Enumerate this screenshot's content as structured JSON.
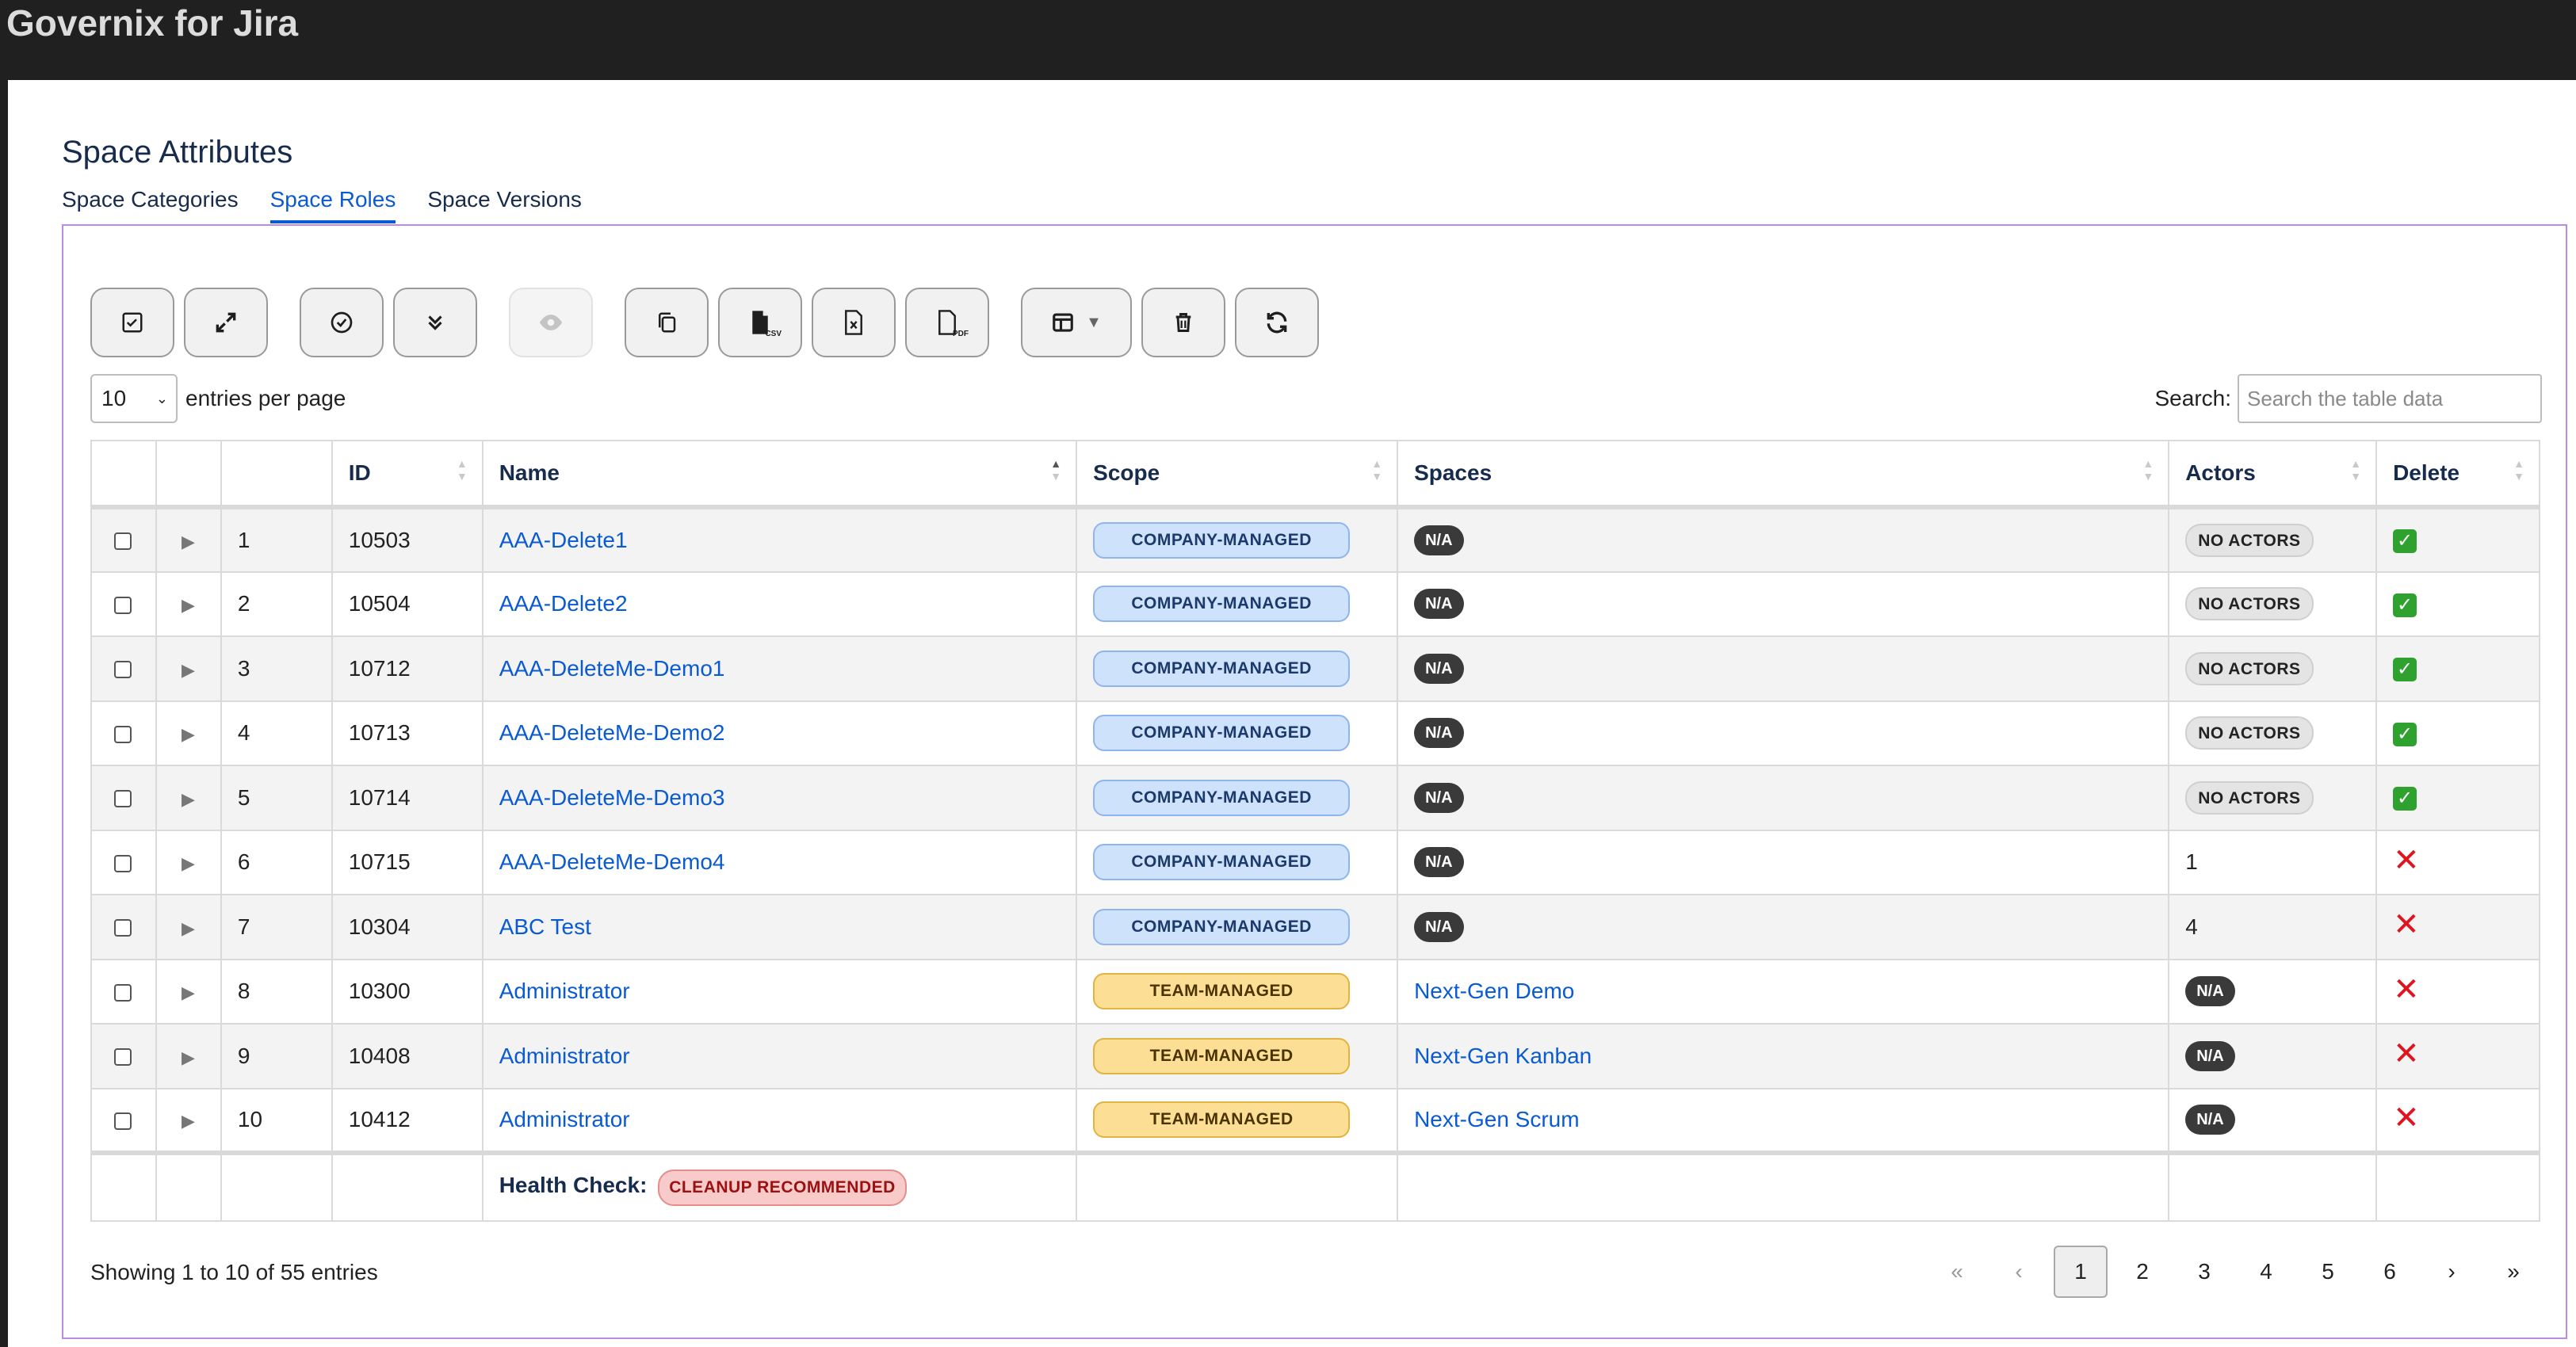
{
  "app": {
    "title": "Governix for Jira"
  },
  "page": {
    "title": "Space Attributes"
  },
  "tabs": [
    {
      "label": "Space Categories",
      "active": false
    },
    {
      "label": "Space Roles",
      "active": true
    },
    {
      "label": "Space Versions",
      "active": false
    }
  ],
  "toolbar": {
    "buttons": [
      {
        "name": "select-all-button",
        "icon": "checkbox-icon"
      },
      {
        "name": "expand-button",
        "icon": "expand-arrows-icon"
      },
      {
        "name": "check-button",
        "icon": "check-circle-icon"
      },
      {
        "name": "collapse-all-button",
        "icon": "double-chevron-down-icon"
      },
      {
        "name": "view-button",
        "icon": "eye-icon",
        "disabled": true
      },
      {
        "name": "copy-button",
        "icon": "copy-icon"
      },
      {
        "name": "export-csv-button",
        "icon": "csv-file-icon",
        "label": "CSV"
      },
      {
        "name": "export-excel-button",
        "icon": "excel-file-icon"
      },
      {
        "name": "export-pdf-button",
        "icon": "pdf-file-icon",
        "label": "PDF"
      },
      {
        "name": "columns-button",
        "icon": "columns-icon"
      },
      {
        "name": "delete-button",
        "icon": "trash-icon"
      },
      {
        "name": "refresh-button",
        "icon": "refresh-icon"
      }
    ]
  },
  "length": {
    "value": "10",
    "label": "entries per page"
  },
  "search": {
    "label": "Search:",
    "placeholder": "Search the table data"
  },
  "table": {
    "headers": [
      "",
      "",
      "",
      "ID",
      "Name",
      "Scope",
      "Spaces",
      "Actors",
      "Delete"
    ],
    "rows": [
      {
        "n": "1",
        "id": "10503",
        "name": "AAA-Delete1",
        "scope": "COMPANY-MANAGED",
        "scope_type": "company",
        "spaces": "N/A",
        "spaces_type": "badge",
        "actors": "NO ACTORS",
        "actors_type": "noactors",
        "delete": true
      },
      {
        "n": "2",
        "id": "10504",
        "name": "AAA-Delete2",
        "scope": "COMPANY-MANAGED",
        "scope_type": "company",
        "spaces": "N/A",
        "spaces_type": "badge",
        "actors": "NO ACTORS",
        "actors_type": "noactors",
        "delete": true
      },
      {
        "n": "3",
        "id": "10712",
        "name": "AAA-DeleteMe-Demo1",
        "scope": "COMPANY-MANAGED",
        "scope_type": "company",
        "spaces": "N/A",
        "spaces_type": "badge",
        "actors": "NO ACTORS",
        "actors_type": "noactors",
        "delete": true
      },
      {
        "n": "4",
        "id": "10713",
        "name": "AAA-DeleteMe-Demo2",
        "scope": "COMPANY-MANAGED",
        "scope_type": "company",
        "spaces": "N/A",
        "spaces_type": "badge",
        "actors": "NO ACTORS",
        "actors_type": "noactors",
        "delete": true
      },
      {
        "n": "5",
        "id": "10714",
        "name": "AAA-DeleteMe-Demo3",
        "scope": "COMPANY-MANAGED",
        "scope_type": "company",
        "spaces": "N/A",
        "spaces_type": "badge",
        "actors": "NO ACTORS",
        "actors_type": "noactors",
        "delete": true
      },
      {
        "n": "6",
        "id": "10715",
        "name": "AAA-DeleteMe-Demo4",
        "scope": "COMPANY-MANAGED",
        "scope_type": "company",
        "spaces": "N/A",
        "spaces_type": "badge",
        "actors": "1",
        "actors_type": "text",
        "delete": false
      },
      {
        "n": "7",
        "id": "10304",
        "name": "ABC Test",
        "scope": "COMPANY-MANAGED",
        "scope_type": "company",
        "spaces": "N/A",
        "spaces_type": "badge",
        "actors": "4",
        "actors_type": "text",
        "delete": false
      },
      {
        "n": "8",
        "id": "10300",
        "name": "Administrator",
        "scope": "TEAM-MANAGED",
        "scope_type": "team",
        "spaces": "Next-Gen Demo",
        "spaces_type": "link",
        "actors": "N/A",
        "actors_type": "na",
        "delete": false
      },
      {
        "n": "9",
        "id": "10408",
        "name": "Administrator",
        "scope": "TEAM-MANAGED",
        "scope_type": "team",
        "spaces": "Next-Gen Kanban",
        "spaces_type": "link",
        "actors": "N/A",
        "actors_type": "na",
        "delete": false
      },
      {
        "n": "10",
        "id": "10412",
        "name": "Administrator",
        "scope": "TEAM-MANAGED",
        "scope_type": "team",
        "spaces": "Next-Gen Scrum",
        "spaces_type": "link",
        "actors": "N/A",
        "actors_type": "na",
        "delete": false
      }
    ],
    "footer": {
      "label": "Health Check:",
      "badge": "CLEANUP RECOMMENDED"
    }
  },
  "info": "Showing 1 to 10 of 55 entries",
  "pagination": {
    "first": "«",
    "prev": "‹",
    "next": "›",
    "last": "»",
    "pages": [
      "1",
      "2",
      "3",
      "4",
      "5",
      "6"
    ],
    "current": "1"
  },
  "colors": {
    "accent": "#0a5bd1",
    "panel_border": "#b98ae6",
    "topbar": "#202020",
    "delete_yes": "#2fa12f",
    "delete_no": "#e0141f"
  }
}
